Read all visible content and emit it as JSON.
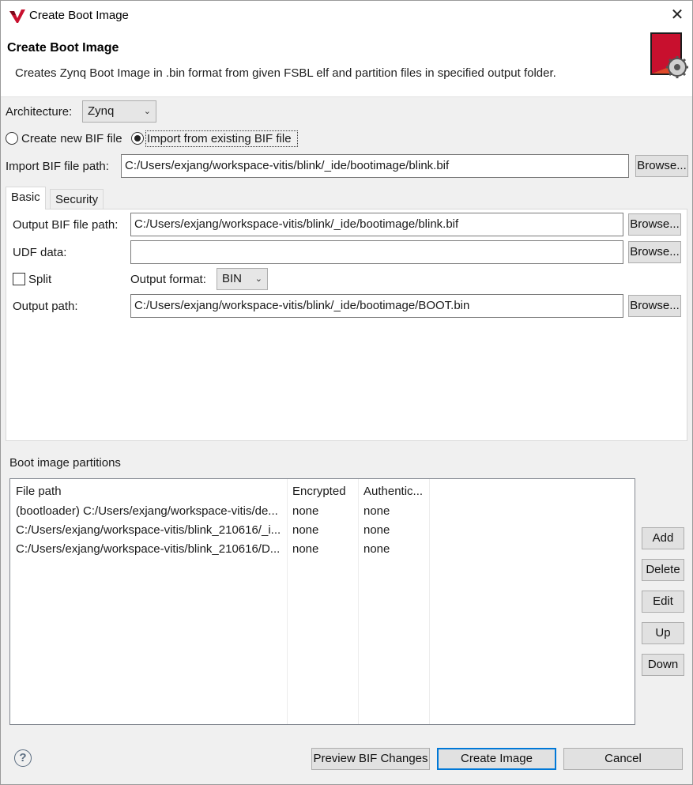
{
  "window": {
    "title": "Create Boot Image",
    "close_glyph": "✕"
  },
  "banner": {
    "title": "Create Boot Image",
    "description": "Creates Zynq Boot Image in .bin format from given FSBL elf and partition files in specified output folder."
  },
  "architecture": {
    "label": "Architecture:",
    "value": "Zynq"
  },
  "bif_mode": {
    "create_label": "Create new BIF file",
    "import_label": "Import from existing BIF file",
    "selected": "import"
  },
  "import_bif": {
    "label": "Import BIF file path:",
    "value": "C:/Users/exjang/workspace-vitis/blink/_ide/bootimage/blink.bif",
    "browse": "Browse..."
  },
  "tabs": [
    {
      "label": "Basic",
      "active": true
    },
    {
      "label": "Security",
      "active": false
    }
  ],
  "basic": {
    "output_bif": {
      "label": "Output BIF file path:",
      "value": "C:/Users/exjang/workspace-vitis/blink/_ide/bootimage/blink.bif",
      "browse": "Browse..."
    },
    "udf": {
      "label": "UDF data:",
      "value": "",
      "browse": "Browse..."
    },
    "split": {
      "label": "Split",
      "checked": false
    },
    "output_format": {
      "label": "Output format:",
      "value": "BIN"
    },
    "output_path": {
      "label": "Output path:",
      "value": "C:/Users/exjang/workspace-vitis/blink/_ide/bootimage/BOOT.bin",
      "browse": "Browse..."
    }
  },
  "partitions": {
    "group_label": "Boot image partitions",
    "columns": [
      "File path",
      "Encrypted",
      "Authentic..."
    ],
    "rows": [
      [
        "(bootloader) C:/Users/exjang/workspace-vitis/de...",
        "none",
        "none"
      ],
      [
        "C:/Users/exjang/workspace-vitis/blink_210616/_i...",
        "none",
        "none"
      ],
      [
        "C:/Users/exjang/workspace-vitis/blink_210616/D...",
        "none",
        "none"
      ]
    ],
    "buttons": {
      "add": "Add",
      "delete": "Delete",
      "edit": "Edit",
      "up": "Up",
      "down": "Down"
    }
  },
  "footer": {
    "help": "?",
    "preview": "Preview BIF Changes",
    "create": "Create Image",
    "cancel": "Cancel"
  },
  "icons": {
    "app": "vitis-logo-icon",
    "banner": "boot-image-gear-icon",
    "help": "help-icon",
    "dropdown": "chevron-down-icon"
  },
  "colors": {
    "default_button_border": "#0078d7",
    "logo_red": "#c8102e"
  }
}
